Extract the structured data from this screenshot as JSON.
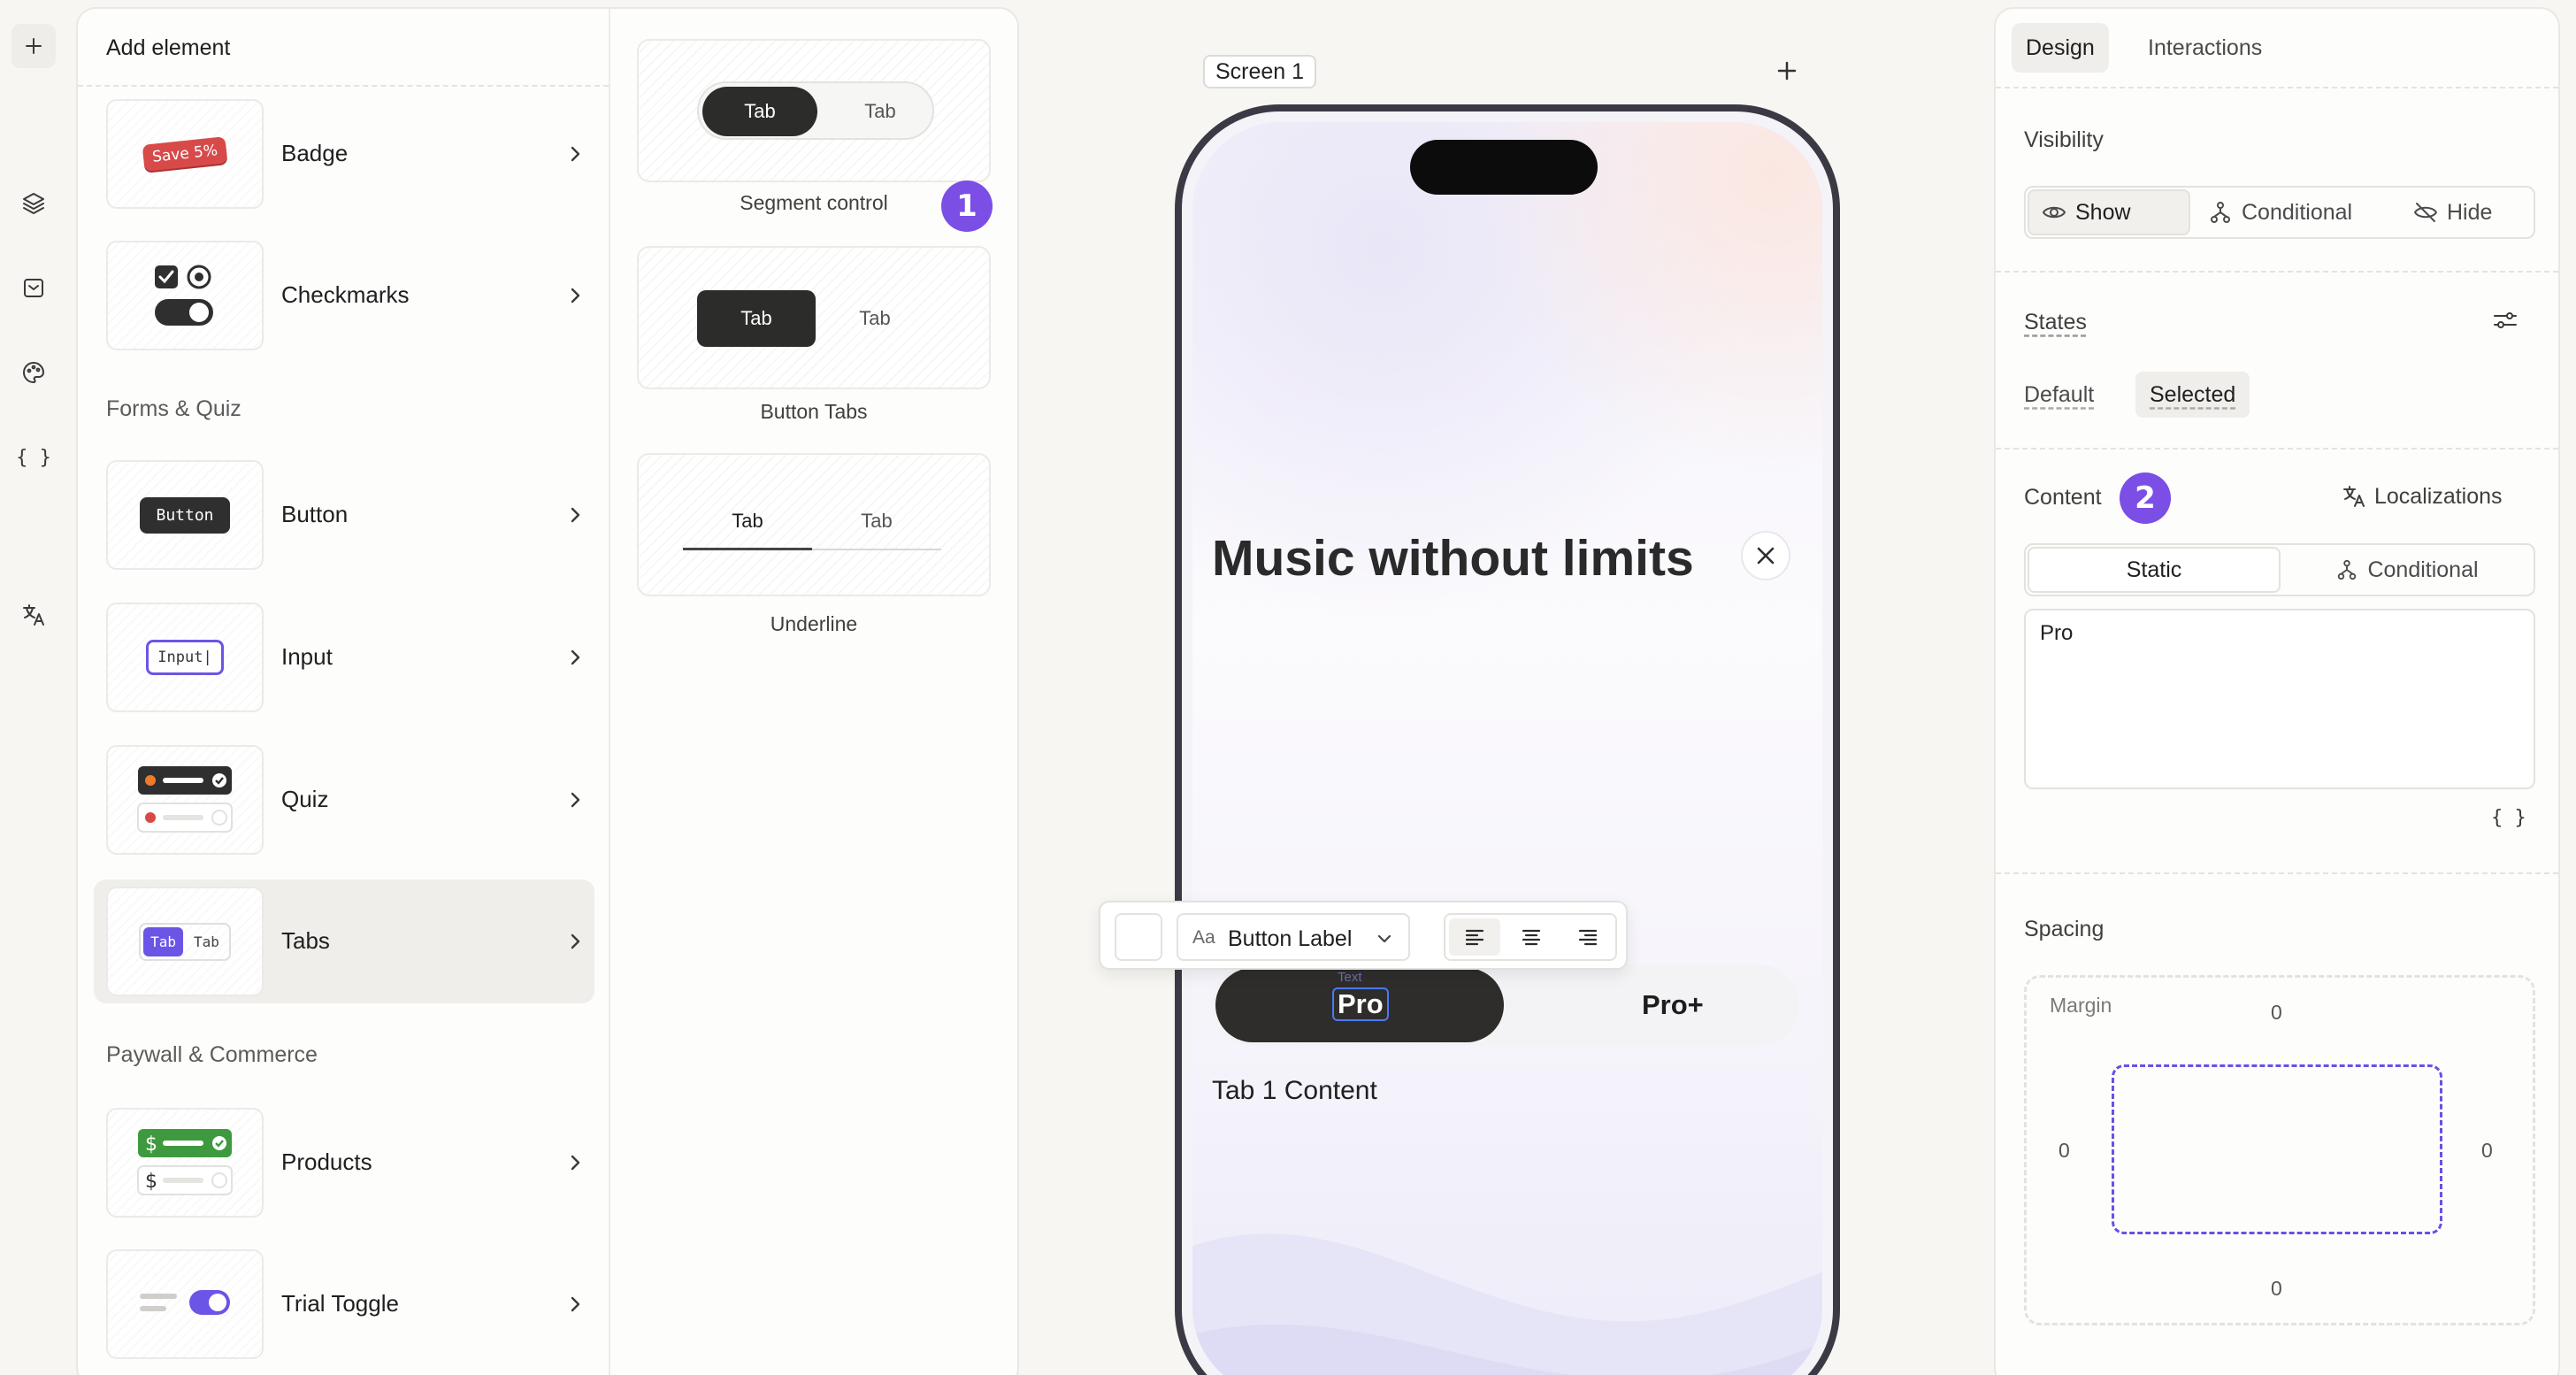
{
  "sidebar": {
    "add_label": "+",
    "code_label": "{ }"
  },
  "add_panel": {
    "title": "Add element",
    "categories": {
      "forms": "Forms & Quiz",
      "paywall": "Paywall & Commerce"
    },
    "items": [
      {
        "label": "Badge"
      },
      {
        "label": "Checkmarks"
      },
      {
        "label": "Button"
      },
      {
        "label": "Input"
      },
      {
        "label": "Quiz"
      },
      {
        "label": "Tabs"
      },
      {
        "label": "Products"
      },
      {
        "label": "Trial Toggle"
      }
    ],
    "thumbs": {
      "badge_text": "Save 5%",
      "button_text": "Button",
      "input_text": "Input|",
      "tab_on": "Tab",
      "tab_off": "Tab",
      "dollar": "$"
    },
    "selected_item": "Tabs"
  },
  "variants": [
    {
      "label": "Segment control",
      "tab_on": "Tab",
      "tab_off": "Tab"
    },
    {
      "label": "Button Tabs",
      "tab_on": "Tab",
      "tab_off": "Tab"
    },
    {
      "label": "Underline",
      "tab_on": "Tab",
      "tab_off": "Tab"
    }
  ],
  "markers": {
    "one": "1",
    "two": "2"
  },
  "canvas": {
    "screen_name": "Screen 1",
    "add_screen": "+",
    "headline": "Music without limits",
    "tabs": {
      "ghost": "Text",
      "tab1": "Pro",
      "tab2": "Pro+"
    },
    "tab_content": "Tab 1 Content"
  },
  "format_toolbar": {
    "aa": "Aa",
    "font_style": "Button Label",
    "alignment": "left"
  },
  "properties": {
    "tabs": {
      "design": "Design",
      "interactions": "Interactions"
    },
    "visibility": {
      "label": "Visibility",
      "options": {
        "show": "Show",
        "conditional": "Conditional",
        "hide": "Hide"
      },
      "selected": "Show"
    },
    "states": {
      "label": "States",
      "default": "Default",
      "selected": "Selected"
    },
    "content": {
      "label": "Content",
      "localizations": "Localizations",
      "static": "Static",
      "conditional": "Conditional",
      "value": "Pro",
      "braces": "{ }"
    },
    "spacing": {
      "label": "Spacing",
      "margin_label": "Margin",
      "top": "0",
      "right": "0",
      "bottom": "0",
      "left": "0"
    }
  },
  "colors": {
    "accent": "#6b55e6",
    "marker": "#7b4ee6",
    "dark": "#2e2d2c"
  }
}
